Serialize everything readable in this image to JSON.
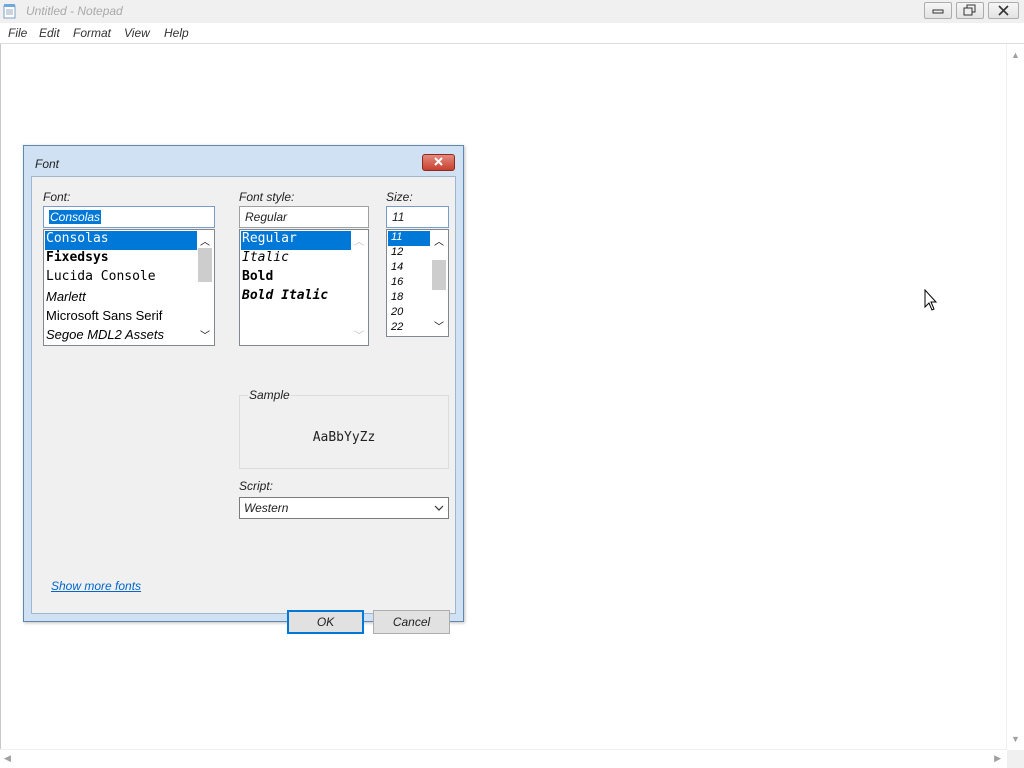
{
  "window": {
    "title": "Untitled - Notepad",
    "menu": [
      "File",
      "Edit",
      "Format",
      "View",
      "Help"
    ],
    "controls": {
      "minimize_icon": "minimize-icon",
      "restore_icon": "restore-icon",
      "close_icon": "close-icon"
    }
  },
  "font_dialog": {
    "title": "Font",
    "font": {
      "label": "Font:",
      "value": "Consolas",
      "items": [
        {
          "name": "Consolas",
          "selected": true
        },
        {
          "name": "Fixedsys",
          "selected": false
        },
        {
          "name": "Lucida Console",
          "selected": false
        },
        {
          "name": "Marlett",
          "selected": false
        },
        {
          "name": "Microsoft Sans Serif",
          "selected": false
        },
        {
          "name": "Segoe MDL2 Assets",
          "selected": false
        }
      ]
    },
    "font_style": {
      "label": "Font style:",
      "value": "Regular",
      "items": [
        {
          "name": "Regular",
          "selected": true
        },
        {
          "name": "Italic",
          "selected": false
        },
        {
          "name": "Bold",
          "selected": false
        },
        {
          "name": "Bold Italic",
          "selected": false
        }
      ]
    },
    "size": {
      "label": "Size:",
      "value": "11",
      "items": [
        "11",
        "12",
        "14",
        "16",
        "18",
        "20",
        "22"
      ],
      "selected": "11"
    },
    "sample": {
      "label": "Sample",
      "text": "AaBbYyZz"
    },
    "script": {
      "label": "Script:",
      "value": "Western"
    },
    "show_more_fonts": "Show more fonts",
    "ok_label": "OK",
    "cancel_label": "Cancel"
  },
  "colors": {
    "selection": "#0078d7",
    "link": "#0066cc",
    "dialog_frame": "#cfe1f3",
    "close_button": "#c7412f"
  }
}
